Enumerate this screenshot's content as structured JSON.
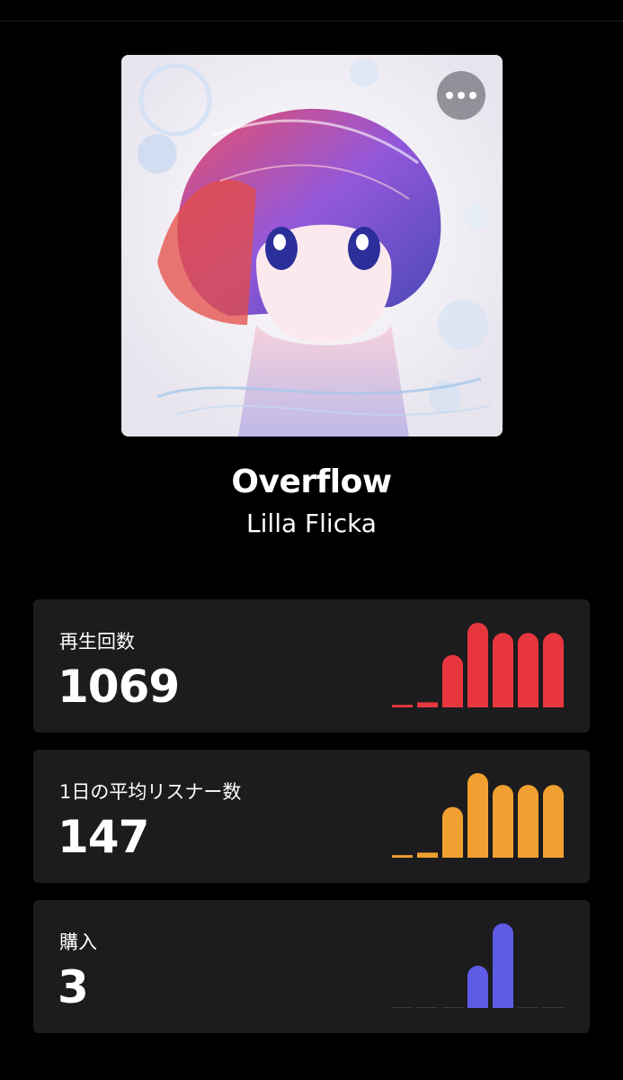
{
  "song": {
    "title": "Overflow",
    "artist": "Lilla Flicka"
  },
  "stats": [
    {
      "label": "再生回数",
      "value": "1069",
      "color": "#e8363e",
      "bars": [
        0.03,
        0.06,
        0.62,
        1.0,
        0.88,
        0.88,
        0.88
      ]
    },
    {
      "label": "1日の平均リスナー数",
      "value": "147",
      "color": "#f0a030",
      "bars": [
        0.03,
        0.06,
        0.6,
        1.0,
        0.86,
        0.86,
        0.86
      ]
    },
    {
      "label": "購入",
      "value": "3",
      "color": "#5e5ce6",
      "bars": [
        0,
        0,
        0,
        0.5,
        1.0,
        0,
        0
      ]
    }
  ],
  "colors": {
    "background": "#000000",
    "card": "#1c1c1e",
    "empty_bar": "#3a3a3c"
  },
  "icons": {
    "more": "ellipsis-icon"
  }
}
